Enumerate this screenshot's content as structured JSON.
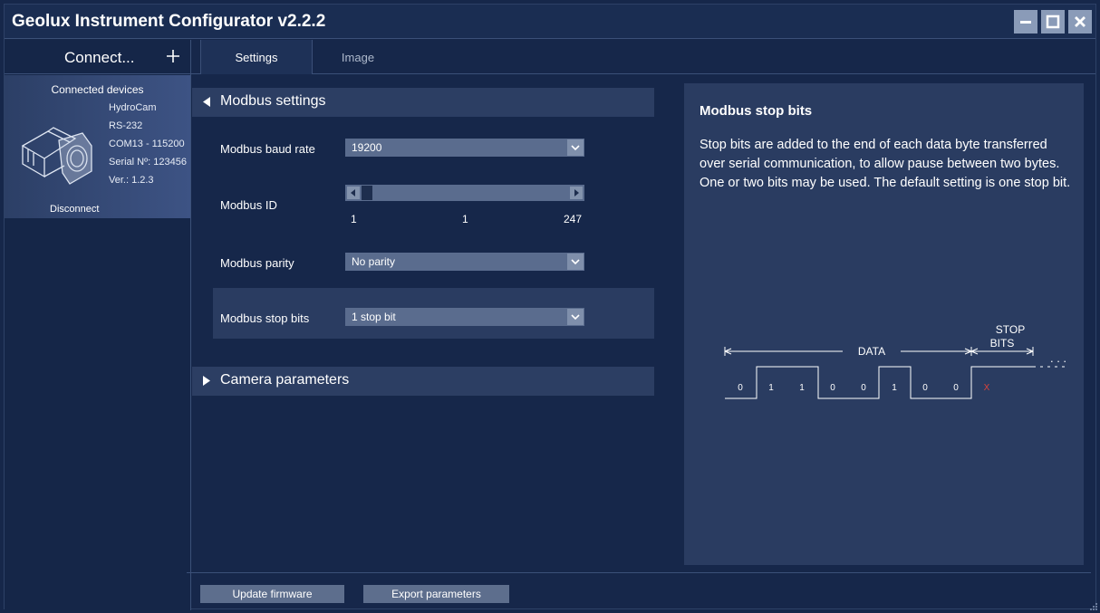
{
  "window": {
    "title": "Geolux Instrument Configurator v2.2.2"
  },
  "sidebar": {
    "connect_label": "Connect...",
    "connected_devices_header": "Connected devices",
    "device": {
      "name": "HydroCam",
      "interface": "RS-232",
      "port": "COM13 - 115200",
      "serial": "Serial Nº: 123456",
      "version": "Ver.: 1.2.3"
    },
    "disconnect_label": "Disconnect"
  },
  "tabs": [
    {
      "label": "Settings",
      "active": true
    },
    {
      "label": "Image",
      "active": false
    }
  ],
  "modbus_section": {
    "title": "Modbus settings",
    "expanded": true,
    "baud_rate": {
      "label": "Modbus baud rate",
      "value": "19200"
    },
    "modbus_id": {
      "label": "Modbus ID",
      "min": "1",
      "current": "1",
      "max": "247",
      "value": 1
    },
    "parity": {
      "label": "Modbus parity",
      "value": "No parity"
    },
    "stop_bits": {
      "label": "Modbus stop bits",
      "value": "1 stop bit"
    }
  },
  "camera_section": {
    "title": "Camera parameters",
    "expanded": false
  },
  "help_panel": {
    "title": "Modbus stop bits",
    "body": "Stop bits are added to the end of each data byte transferred over serial communication, to allow pause between two bytes. One or two bits may be used. The default setting is one stop bit.",
    "diagram": {
      "data_label": "DATA",
      "stop_label_line1": "STOP",
      "stop_label_line2": "BITS",
      "bits": [
        "0",
        "1",
        "1",
        "0",
        "0",
        "1",
        "0",
        "0"
      ],
      "stop_bit": "X",
      "ellipsis": ". . ."
    }
  },
  "footer": {
    "update_firmware_label": "Update firmware",
    "export_parameters_label": "Export parameters"
  },
  "colors": {
    "background": "#16274a",
    "panel": "#2a3c61",
    "section_header": "#2c3e63",
    "control": "#5a6c8e",
    "stop_bit_red": "#d9433b"
  }
}
